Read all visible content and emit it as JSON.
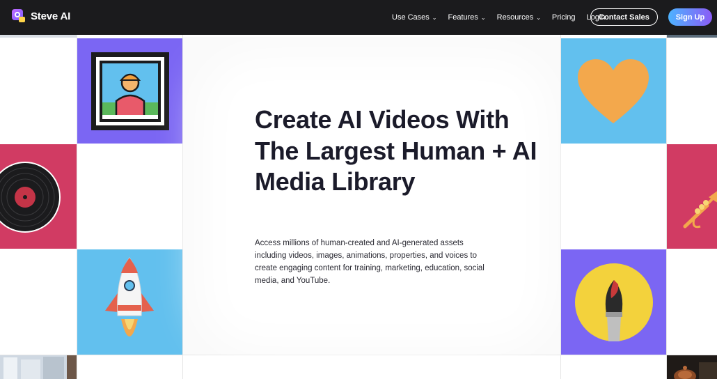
{
  "brand": {
    "name": "Steve AI"
  },
  "nav": {
    "items": [
      {
        "label": "Use Cases",
        "has_dropdown": true
      },
      {
        "label": "Features",
        "has_dropdown": true
      },
      {
        "label": "Resources",
        "has_dropdown": true
      },
      {
        "label": "Pricing",
        "has_dropdown": false
      },
      {
        "label": "Login",
        "has_dropdown": false
      }
    ],
    "contact_label": "Contact Sales",
    "signup_label": "Sign Up"
  },
  "hero": {
    "title": "Create AI Videos With The Largest Human + AI Media Library",
    "description": "Access millions of human-created and AI-generated assets including videos, images, animations, properties, and voices to create engaging content for training, marketing, education, social media, and YouTube."
  },
  "tiles": [
    {
      "name": "framed-portrait",
      "icon": "framed-portrait-icon",
      "bg": "#7b66f3"
    },
    {
      "name": "vinyl-record",
      "icon": "vinyl-record-icon",
      "bg": "#d13b63"
    },
    {
      "name": "rocket",
      "icon": "rocket-icon",
      "bg": "#62c0ee"
    },
    {
      "name": "heart",
      "icon": "heart-icon",
      "bg": "#62c0ee"
    },
    {
      "name": "trumpet",
      "icon": "trumpet-icon",
      "bg": "#d13b63"
    },
    {
      "name": "paintbrush",
      "icon": "paintbrush-icon",
      "bg": "#7b66f3"
    }
  ],
  "colors": {
    "nav_bg": "#1b1b1d",
    "purple": "#7b66f3",
    "pink": "#d13b63",
    "sky": "#62c0ee",
    "heart_orange": "#f3a84c",
    "brush_yellow": "#f3d23c",
    "signup_gradient_start": "#4db3ff",
    "signup_gradient_end": "#8b5cf6"
  }
}
